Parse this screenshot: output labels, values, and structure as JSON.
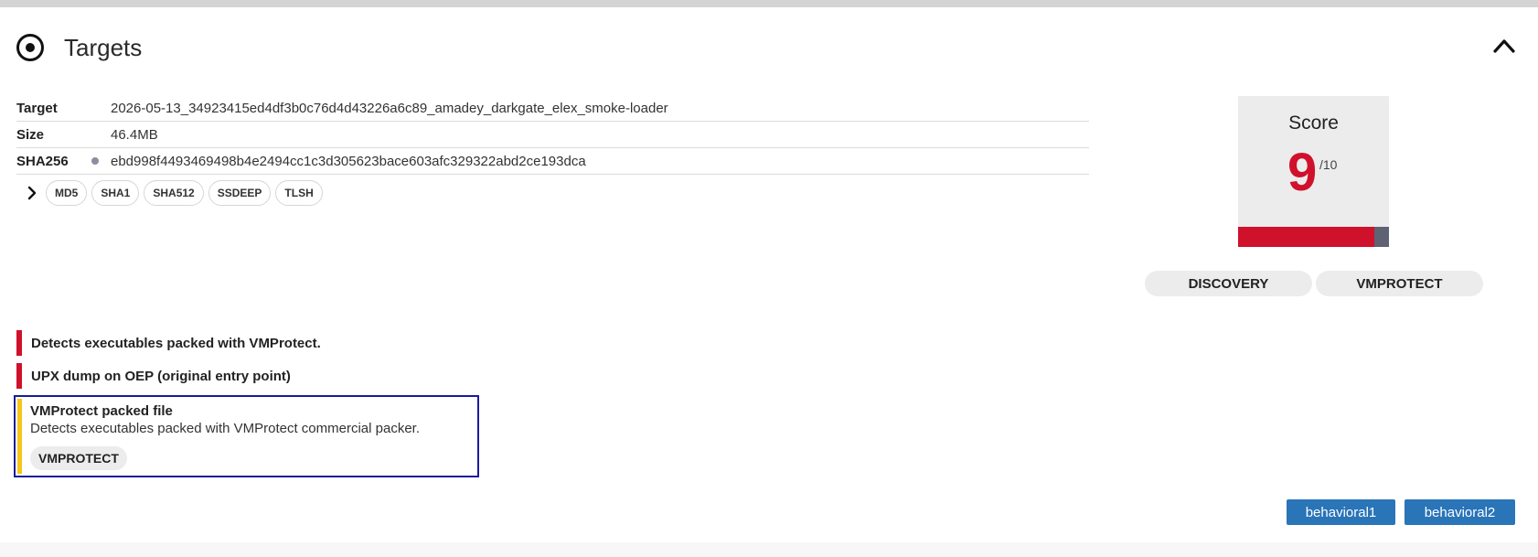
{
  "section": {
    "title": "Targets",
    "icon": "target-icon",
    "collapse_icon": "chevron-up-icon"
  },
  "target": {
    "target_label": "Target",
    "target_value": "2026-05-13_34923415ed4df3b0c76d4d43226a6c89_amadey_darkgate_elex_smoke-loader",
    "size_label": "Size",
    "size_value": "46.4MB",
    "sha256_label": "SHA256",
    "sha256_value": "ebd998f4493469498b4e2494cc1c3d305623bace603afc329322abd2ce193dca",
    "hash_buttons": [
      "MD5",
      "SHA1",
      "SHA512",
      "SSDEEP",
      "TLSH"
    ]
  },
  "score": {
    "label": "Score",
    "value": "9",
    "max": "/10",
    "fill_fraction": 0.9,
    "colors": {
      "high": "#d0112b",
      "rest": "#5e6273"
    }
  },
  "tags": [
    "DISCOVERY",
    "VMPROTECT"
  ],
  "signatures": [
    {
      "title": "Detects executables packed with VMProtect.",
      "severity_color": "#d0112b"
    },
    {
      "title": "UPX dump on OEP (original entry point)",
      "severity_color": "#d0112b"
    },
    {
      "title": "VMProtect packed file",
      "description": "Detects executables packed with VMProtect commercial packer.",
      "tag": "VMPROTECT",
      "severity_color": "#f5c518"
    }
  ],
  "tasks": [
    "behavioral1",
    "behavioral2"
  ],
  "colors": {
    "accent": "#2a74b8",
    "selection_border": "#1a1a9c"
  }
}
